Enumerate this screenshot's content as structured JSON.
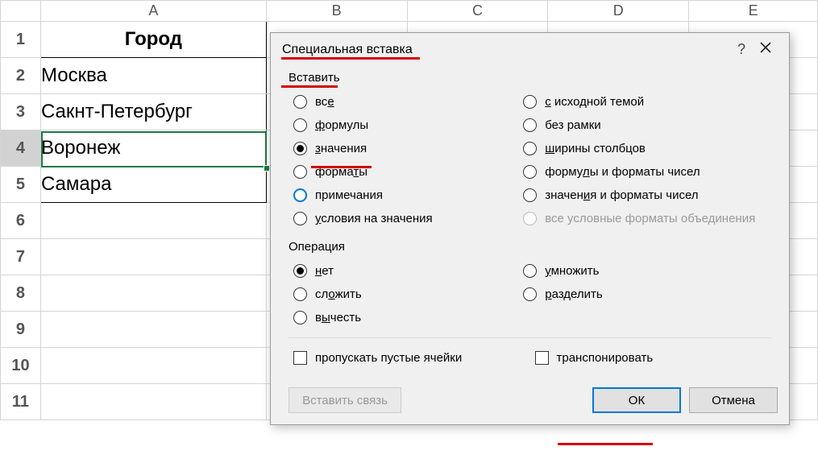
{
  "columns": [
    "A",
    "B",
    "C",
    "D",
    "E"
  ],
  "rows": [
    "1",
    "2",
    "3",
    "4",
    "5",
    "6",
    "7",
    "8",
    "9",
    "10",
    "11"
  ],
  "cells": {
    "A1": "Город",
    "A2": "Москва",
    "A3": "Сакнт-Петербург",
    "A4": " Воронеж",
    "A5": "   Самара"
  },
  "dialog": {
    "title": "Специальная вставка",
    "help": "?",
    "group_paste": "Вставить",
    "paste_left": [
      {
        "key": "all",
        "label": "все",
        "u": 2,
        "checked": false
      },
      {
        "key": "formulas",
        "label": "формулы",
        "u": 0,
        "checked": false
      },
      {
        "key": "values",
        "label": "значения",
        "u": 0,
        "checked": true
      },
      {
        "key": "formats",
        "label": "форматы",
        "u": 5,
        "checked": false
      },
      {
        "key": "comments",
        "label": "примечания",
        "u": -1,
        "checked": false,
        "focus": true
      },
      {
        "key": "validation",
        "label": "условия на значения",
        "u": 0,
        "checked": false
      }
    ],
    "paste_right": [
      {
        "key": "theme",
        "label": "с исходной темой",
        "u": 0,
        "checked": false
      },
      {
        "key": "noborder",
        "label": "без рамки",
        "u": -1,
        "checked": false
      },
      {
        "key": "widths",
        "label": "ширины столбцов",
        "u": 0,
        "checked": false
      },
      {
        "key": "formnum",
        "label": "формулы и форматы чисел",
        "u": 5,
        "checked": false
      },
      {
        "key": "valnum",
        "label": "значения и форматы чисел",
        "u": 6,
        "checked": false
      },
      {
        "key": "allmerge",
        "label": "все условные форматы объединения",
        "u": -1,
        "checked": false,
        "disabled": true
      }
    ],
    "group_op": "Операция",
    "op_left": [
      {
        "key": "none",
        "label": "нет",
        "u": 0,
        "checked": true
      },
      {
        "key": "add",
        "label": "сложить",
        "u": 2,
        "checked": false
      },
      {
        "key": "sub",
        "label": "вычесть",
        "u": 1,
        "checked": false
      }
    ],
    "op_right": [
      {
        "key": "mul",
        "label": "умножить",
        "u": 0,
        "checked": false
      },
      {
        "key": "div",
        "label": "разделить",
        "u": 0,
        "checked": false
      }
    ],
    "skip_blanks": "пропускать пустые ячейки",
    "transpose": "транспонировать",
    "paste_link": "Вставить связь",
    "ok": "ОК",
    "cancel": "Отмена"
  }
}
